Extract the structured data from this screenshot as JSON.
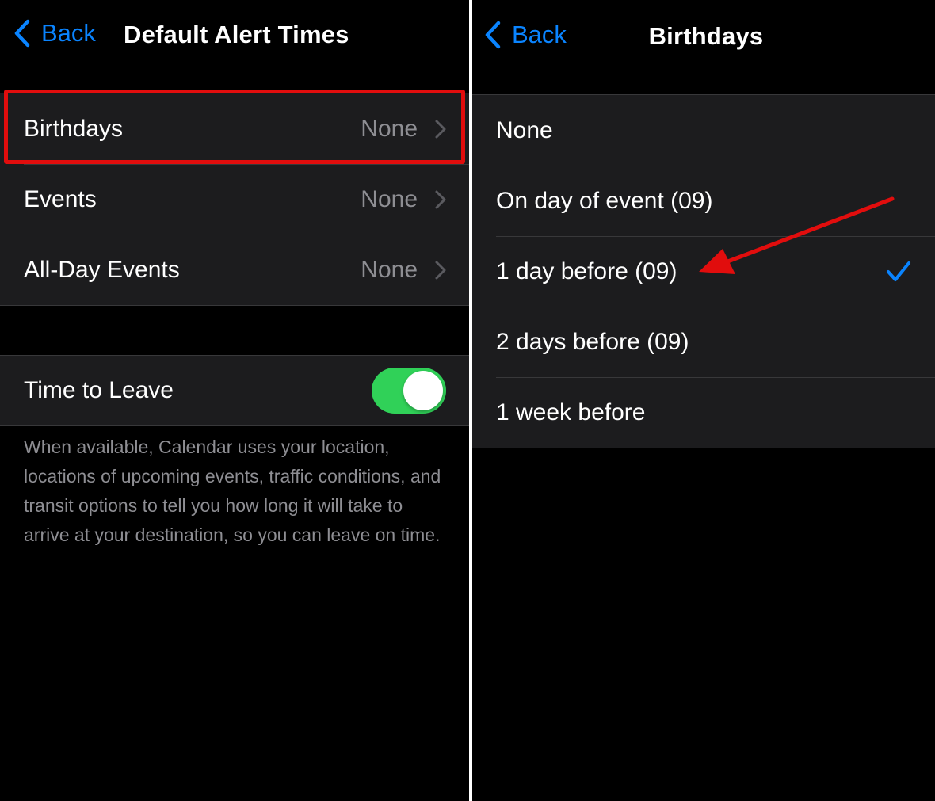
{
  "left": {
    "nav": {
      "back_label": "Back",
      "title": "Default Alert Times"
    },
    "alerts": [
      {
        "label": "Birthdays",
        "value": "None"
      },
      {
        "label": "Events",
        "value": "None"
      },
      {
        "label": "All-Day Events",
        "value": "None"
      }
    ],
    "time_to_leave": {
      "label": "Time to Leave",
      "enabled": true,
      "footer": "When available, Calendar uses your location, locations of upcoming events, traffic conditions, and transit options to tell you how long it will take to arrive at your destination, so you can leave on time."
    }
  },
  "right": {
    "nav": {
      "back_label": "Back",
      "title": "Birthdays"
    },
    "options": [
      {
        "label": "None",
        "selected": false
      },
      {
        "label": "On day of event (09)",
        "selected": false
      },
      {
        "label": "1 day before (09)",
        "selected": true
      },
      {
        "label": "2 days before (09)",
        "selected": false
      },
      {
        "label": "1 week before",
        "selected": false
      }
    ]
  },
  "colors": {
    "accent": "#0a84ff",
    "toggle_on": "#30d158",
    "annotation": "#e10d0d",
    "cell_background": "#1c1c1e",
    "secondary_text": "#8e8e93"
  },
  "icons": {
    "back": "chevron-left-icon",
    "disclosure": "chevron-right-icon",
    "selected": "checkmark-icon",
    "annotation": "red-arrow-annotation"
  }
}
